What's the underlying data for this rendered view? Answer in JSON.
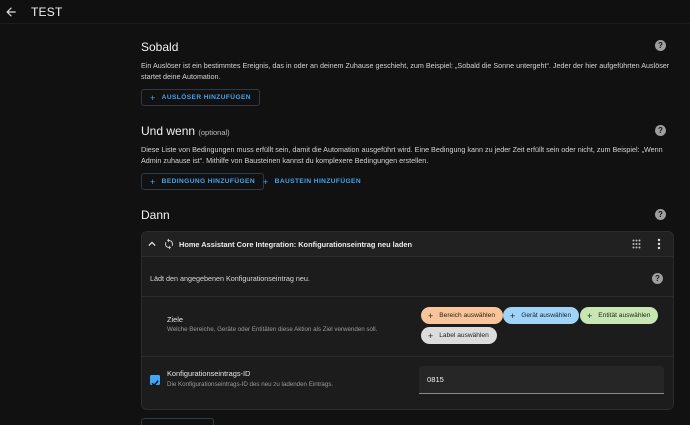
{
  "app": {
    "title": "TEST"
  },
  "sections": {
    "sobald": {
      "title": "Sobald",
      "description": "Ein Auslöser ist ein bestimmtes Ereignis, das in oder an deinem Zuhause geschieht, zum Beispiel: „Sobald die Sonne untergeht“. Jeder der hier aufgeführten Auslöser startet deine Automation.",
      "add_trigger_label": "AUSLÖSER HINZUFÜGEN"
    },
    "und_wenn": {
      "title": "Und wenn",
      "optional_label": "(optional)",
      "description": "Diese Liste von Bedingungen muss erfüllt sein, damit die Automation ausgeführt wird. Eine Bedingung kann zu jeder Zeit erfüllt sein oder nicht, zum Beispiel: „Wenn Admin zuhause ist“. Mithilfe von Bausteinen kannst du komplexere Bedingungen erstellen.",
      "add_condition_label": "BEDINGUNG HINZUFÜGEN",
      "add_building_block_label": "BAUSTEIN HINZUFÜGEN"
    },
    "dann": {
      "title": "Dann"
    }
  },
  "action_card": {
    "title": "Home Assistant Core Integration: Konfigurationseintrag neu laden",
    "description": "Lädt den angegebenen Konfigurationseintrag neu.",
    "targets": {
      "label": "Ziele",
      "sublabel": "Welche Bereiche, Geräte oder Entitäten diese Aktion als Ziel verwenden soll.",
      "chips": [
        {
          "label": "Bereich auswählen",
          "bg": "#f8c49a",
          "fg": "#2b2016"
        },
        {
          "label": "Gerät auswählen",
          "bg": "#9fd3f7",
          "fg": "#15232e"
        },
        {
          "label": "Entität auswählen",
          "bg": "#c7e6b3",
          "fg": "#1c2616"
        },
        {
          "label": "Label auswählen",
          "bg": "#dcdcdc",
          "fg": "#222222"
        }
      ]
    },
    "config_entry": {
      "label": "Konfigurationseintrags-ID",
      "sublabel": "Die Konfigurationseintrags-ID des neu zu ladenden Eintrags.",
      "value": "0815",
      "checked": true
    }
  },
  "icons": {
    "back": "arrow-left-icon",
    "help": "help-circle-icon",
    "collapse": "chevron-up-icon",
    "action": "sync-icon",
    "drag": "drag-handle-icon",
    "more": "more-vertical-icon"
  },
  "colors": {
    "accent": "#44a4f0",
    "background": "#111111",
    "card": "#1c1c1c"
  }
}
